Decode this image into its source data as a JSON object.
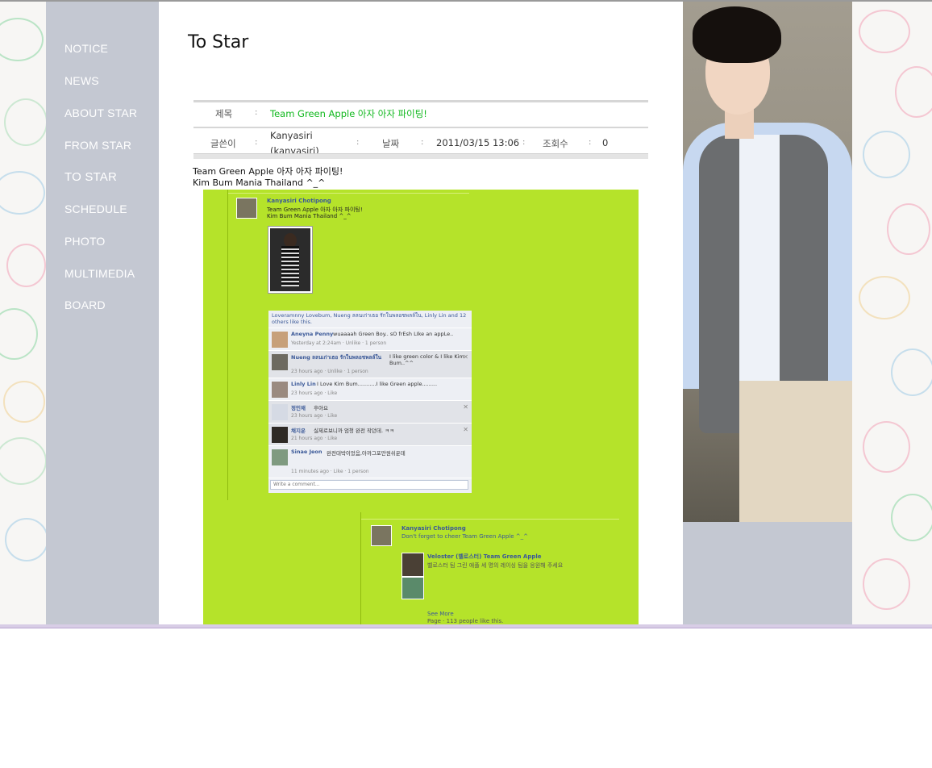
{
  "nav": {
    "items": [
      {
        "label": "NOTICE"
      },
      {
        "label": "NEWS"
      },
      {
        "label": "ABOUT STAR"
      },
      {
        "label": "FROM STAR"
      },
      {
        "label": "TO STAR"
      },
      {
        "label": "SCHEDULE"
      },
      {
        "label": "PHOTO"
      },
      {
        "label": "MULTIMEDIA"
      },
      {
        "label": "BOARD"
      }
    ]
  },
  "page": {
    "title": "To Star"
  },
  "post": {
    "subject_label": "제목",
    "subject": "Team Green Apple 아자 아자 파이팅!",
    "writer_label": "글쓴이",
    "writer_name": "Kanyasiri",
    "writer_id": "(kanyasiri)",
    "date_label": "날짜",
    "date": "2011/03/15 13:06",
    "views_label": "조회수",
    "views": "0",
    "sep": ":",
    "body_line1": "Team Green Apple 아자 아자 파이팅!",
    "body_line2": "Kim Bum Mania Thailand ^_^"
  },
  "fb": {
    "poster_name": "Kanyasiri Chotipong",
    "poster_line1": "Team Green Apple 아자 아자 파이팅!",
    "poster_line2": "Kim Bum Mania Thailand ^_^",
    "likes_text": "Loveramnny Lovebum, Nueng ลลนเก่าเธอ รักในพลอชพลล์ใน, Linly Lin and 12 others like this.",
    "comments": [
      {
        "name": "Aneyna Penny",
        "text": "wuaaaah Green Boy.. sO frEsh LIke an appLe..",
        "meta": "Yesterday at 2:24am · Unlike · 1 person"
      },
      {
        "name": "Nueng ลลนเก่าเธอ รักในพลอชพลล์ใน",
        "text": "I like green color & I like Kim Bum..^^",
        "meta": "23 hours ago · Unlike · 1 person"
      },
      {
        "name": "Linly Lin",
        "text": "I Love Kim Bum...........I like Green apple.........",
        "meta": "23 hours ago · Like"
      },
      {
        "name": "정민채",
        "text": "후아요",
        "meta": "23 hours ago · Like"
      },
      {
        "name": "채지운",
        "text": "실제로보니까 엄청 완전 작던데. ㅋㅋ",
        "meta": "21 hours ago · Like"
      },
      {
        "name": "Sinae Jeon",
        "text": "완전대박이었음,아까그포만원쉬운데",
        "meta": "11 minutes ago · Like · 1 person"
      }
    ],
    "write_placeholder": "Write a comment...",
    "poster2_name": "Kanyasiri Chotipong",
    "poster2_line": "Don't forget to cheer Team Green Apple ^_^",
    "share_name": "Veloster (벨로스터) Team Green Apple",
    "share_text": "벨로스터 팀 그린 애플 세 명의 레이싱 팀을 응원해 주세요",
    "see_more": "See More",
    "share_likes": "Page · 113 people like this."
  }
}
